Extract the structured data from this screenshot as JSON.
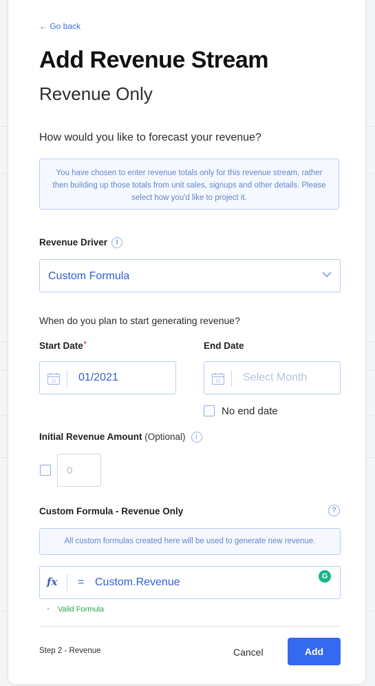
{
  "nav": {
    "go_back": "← Go back"
  },
  "header": {
    "title": "Add Revenue Stream",
    "subtitle": "Revenue Only"
  },
  "forecast": {
    "question": "How would you like to forecast your revenue?",
    "info": "You have chosen to enter revenue totals only for this revenue stream, rather then building up those totals from unit sales, signups and other details. Please select how you'd like to project it."
  },
  "driver": {
    "label": "Revenue Driver",
    "selected": "Custom Formula"
  },
  "dates": {
    "question": "When do you plan to start generating revenue?",
    "start_label": "Start Date",
    "required_mark": "*",
    "start_value": "01/2021",
    "end_label": "End Date",
    "end_placeholder": "Select Month",
    "no_end_label": "No end date",
    "calendar_day": "31"
  },
  "initial_amount": {
    "label": "Initial Revenue Amount",
    "optional": "(Optional)",
    "placeholder": "0"
  },
  "formula": {
    "label": "Custom Formula - Revenue Only",
    "note": "All custom formulas created here will be used to generate new revenue.",
    "fx_symbol": "fx",
    "equals": "=",
    "value": "Custom.Revenue",
    "status": "Valid Formula"
  },
  "footer": {
    "step": "Step 2 - Revenue",
    "cancel": "Cancel",
    "add": "Add"
  },
  "icons": {
    "info": "info-icon",
    "calendar": "calendar-icon",
    "chevron": "chevron-down-icon",
    "help": "help-icon",
    "grammarly": "grammarly-icon"
  },
  "colors": {
    "accent": "#3569ef",
    "link": "#3b6fe0",
    "valid": "#2ea04a",
    "required": "#e03131"
  }
}
